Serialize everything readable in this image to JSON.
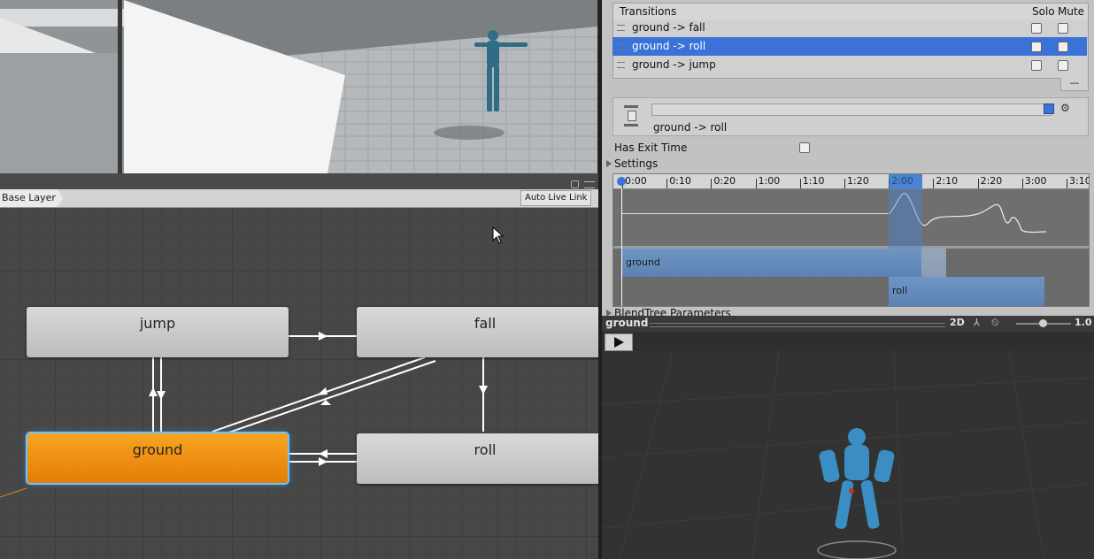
{
  "animator": {
    "breadcrumb": "Base Layer",
    "auto_live_link": "Auto Live Link",
    "states": {
      "jump": "jump",
      "fall": "fall",
      "ground": "ground",
      "roll": "roll"
    }
  },
  "transitions": {
    "header": "Transitions",
    "solo": "Solo",
    "mute": "Mute",
    "items": [
      {
        "label": "ground -> fall",
        "selected": false
      },
      {
        "label": "ground -> roll",
        "selected": true
      },
      {
        "label": "ground -> jump",
        "selected": false
      }
    ],
    "remove_symbol": "—"
  },
  "transition_detail": {
    "name": "ground -> roll",
    "has_exit_time_label": "Has Exit Time",
    "settings_label": "Settings"
  },
  "timeline": {
    "ticks": [
      "0:00",
      "0:10",
      "0:20",
      "1:00",
      "1:10",
      "1:20",
      "2:00",
      "2:10",
      "2:20",
      "3:00",
      "3:10"
    ],
    "source_clip": "ground",
    "dest_clip": "roll"
  },
  "blendtree_label": "BlendTree Parameters",
  "preview": {
    "clip_name": "ground",
    "mode": "2D",
    "speed": "1.0"
  },
  "colors": {
    "selection": "#3a72d8",
    "default_state": "#f39a14",
    "timeline_highlight": "#4a86d0"
  }
}
